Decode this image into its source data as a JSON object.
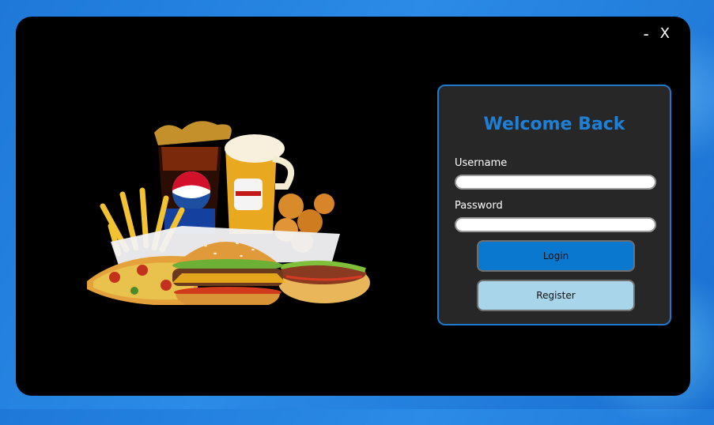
{
  "window": {
    "controls": {
      "minimize": "-",
      "close": "X"
    }
  },
  "login_card": {
    "title": "Welcome Back",
    "username_label": "Username",
    "username_value": "",
    "password_label": "Password",
    "password_value": "",
    "login_button": "Login",
    "register_button": "Register"
  },
  "colors": {
    "accent": "#1d80d6",
    "card_background": "#272727",
    "login_button": "#0a78cf",
    "register_button": "#a9d5ea"
  },
  "image": {
    "name": "fast-food-collage"
  }
}
